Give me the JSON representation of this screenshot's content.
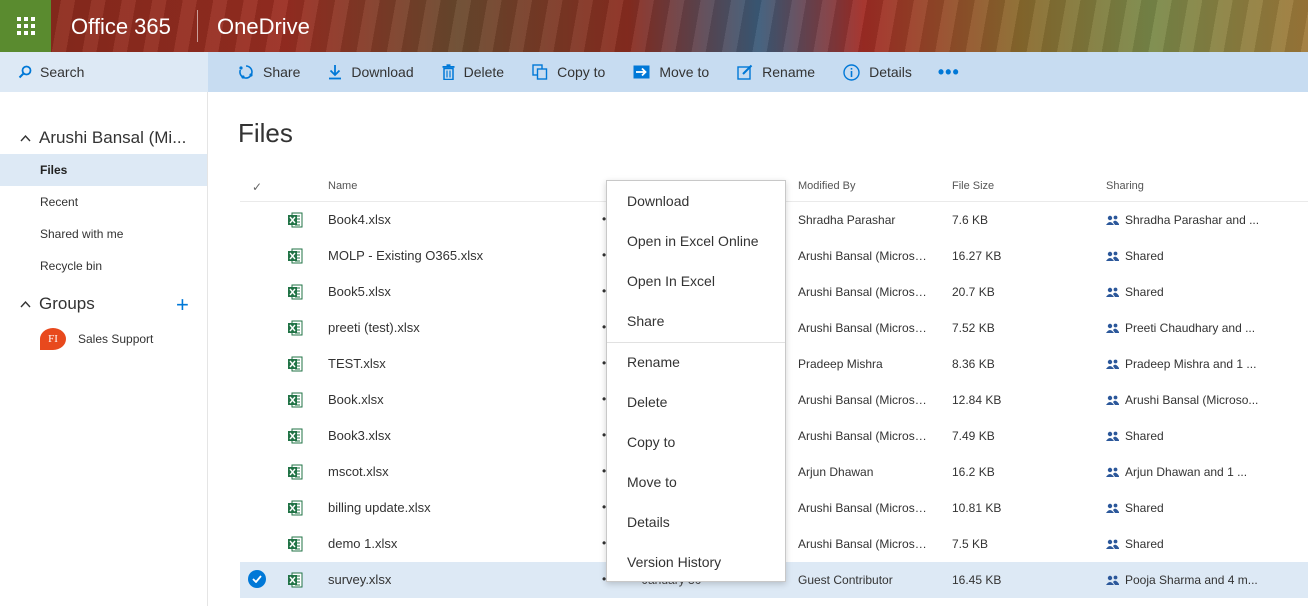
{
  "header": {
    "brand": "Office 365",
    "app_name": "OneDrive"
  },
  "search": {
    "label": "Search"
  },
  "commands": [
    {
      "label": "Share",
      "icon": "share-icon"
    },
    {
      "label": "Download",
      "icon": "download-icon"
    },
    {
      "label": "Delete",
      "icon": "delete-icon"
    },
    {
      "label": "Copy to",
      "icon": "copy-icon"
    },
    {
      "label": "Move to",
      "icon": "move-icon"
    },
    {
      "label": "Rename",
      "icon": "rename-icon"
    },
    {
      "label": "Details",
      "icon": "info-icon"
    },
    {
      "label": "•••",
      "icon": "more-icon"
    }
  ],
  "nav": {
    "user": "Arushi Bansal (Mi...",
    "items": [
      "Files",
      "Recent",
      "Shared with me",
      "Recycle bin"
    ],
    "active": "Files",
    "groups_label": "Groups",
    "add_label": "+",
    "group": {
      "initials": "FI",
      "name": "Sales Support"
    }
  },
  "main": {
    "title": "Files",
    "columns": {
      "check": "✓",
      "name": "Name",
      "modified_by": "Modified By",
      "file_size": "File Size",
      "sharing": "Sharing"
    },
    "rows": [
      {
        "name": "Book4.xlsx",
        "modified_by": "Shradha Parashar",
        "size": "7.6 KB",
        "sharing": "Shradha Parashar and ..."
      },
      {
        "name": "MOLP - Existing O365.xlsx",
        "modified_by": "Arushi Bansal (Microso...",
        "size": "16.27 KB",
        "sharing": "Shared"
      },
      {
        "name": "Book5.xlsx",
        "modified_by": "Arushi Bansal (Microso...",
        "size": "20.7 KB",
        "sharing": "Shared"
      },
      {
        "name": "preeti (test).xlsx",
        "modified_by": "Arushi Bansal (Microso...",
        "size": "7.52 KB",
        "sharing": "Preeti Chaudhary and ..."
      },
      {
        "name": "TEST.xlsx",
        "modified_by": "Pradeep Mishra",
        "size": "8.36 KB",
        "sharing": "Pradeep Mishra and 1 ..."
      },
      {
        "name": "Book.xlsx",
        "modified_by": "Arushi Bansal (Microso...",
        "size": "12.84 KB",
        "sharing": "Arushi Bansal (Microso..."
      },
      {
        "name": "Book3.xlsx",
        "modified_by": "Arushi Bansal (Microso...",
        "size": "7.49 KB",
        "sharing": "Shared"
      },
      {
        "name": "mscot.xlsx",
        "modified_by": "Arjun Dhawan",
        "size": "16.2 KB",
        "sharing": "Arjun Dhawan and 1 ..."
      },
      {
        "name": "billing update.xlsx",
        "modified_by": "Arushi Bansal (Microso...",
        "size": "10.81 KB",
        "sharing": "Shared"
      },
      {
        "name": "demo 1.xlsx",
        "modified_by": "Arushi Bansal (Microso...",
        "size": "7.5 KB",
        "sharing": "Shared"
      },
      {
        "name": "survey.xlsx",
        "date": "January 30",
        "modified_by": "Guest Contributor",
        "size": "16.45 KB",
        "sharing": "Pooja Sharma and 4 m...",
        "selected": true
      }
    ]
  },
  "context_menu": {
    "items": [
      "Download",
      "Open in Excel Online",
      "Open In Excel",
      "Share",
      "Rename",
      "Delete",
      "Copy to",
      "Move to",
      "Details",
      "Version History"
    ]
  },
  "colors": {
    "accent": "#0078d7",
    "waffle_bg": "#5a8b2f",
    "cmdbar_bg": "#c7dcf1",
    "selected_bg": "#dde9f5",
    "excel_green": "#217346"
  }
}
